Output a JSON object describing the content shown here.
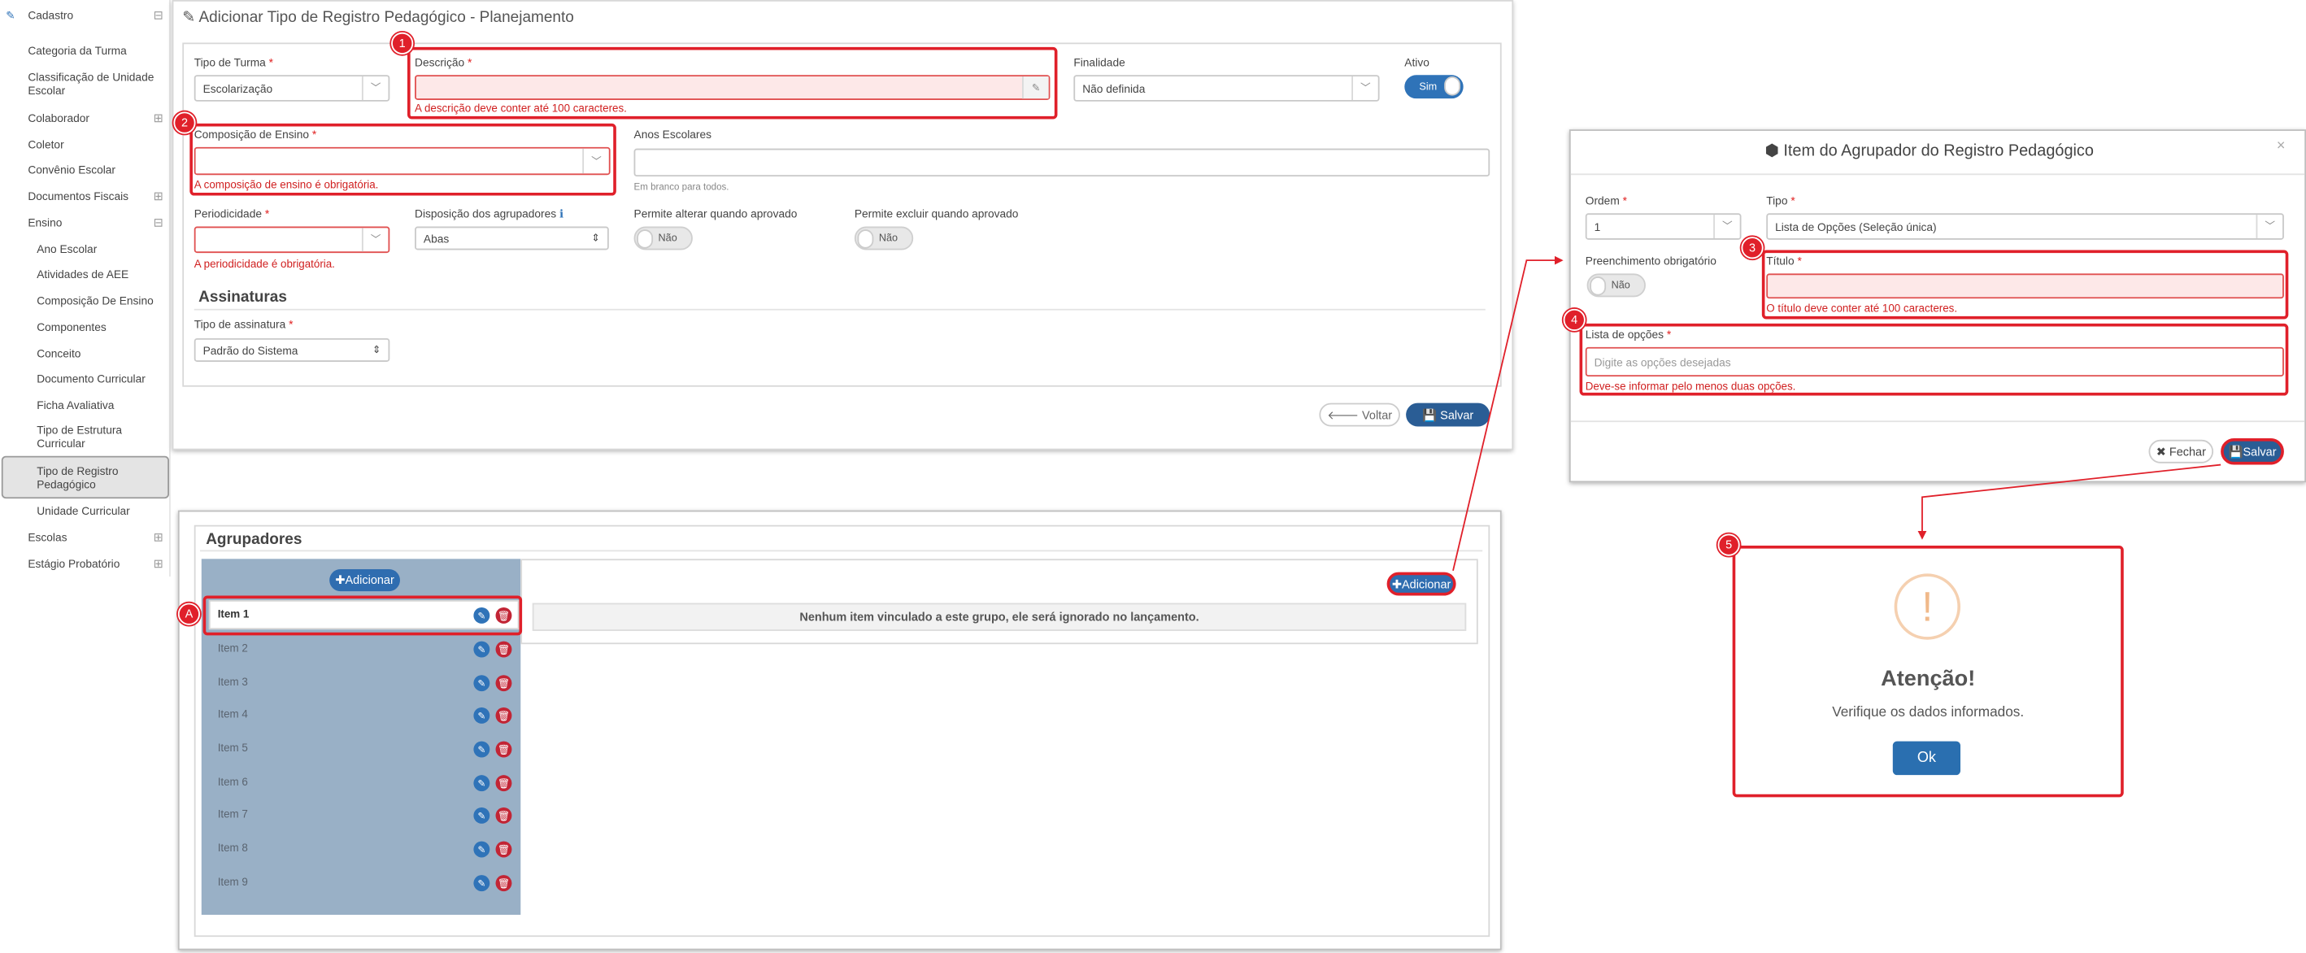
{
  "sidebar": {
    "items": [
      {
        "label": "Cadastro",
        "toggle": "⊟"
      },
      {
        "label": "Categoria da Turma"
      },
      {
        "label": "Classificação de Unidade Escolar"
      },
      {
        "label": "Colaborador",
        "toggle": "⊞"
      },
      {
        "label": "Coletor"
      },
      {
        "label": "Convênio Escolar"
      },
      {
        "label": "Documentos Fiscais",
        "toggle": "⊞"
      },
      {
        "label": "Ensino",
        "toggle": "⊟"
      },
      {
        "label": "Ano Escolar"
      },
      {
        "label": "Atividades de AEE"
      },
      {
        "label": "Composição De Ensino"
      },
      {
        "label": "Componentes"
      },
      {
        "label": "Conceito"
      },
      {
        "label": "Documento Curricular"
      },
      {
        "label": "Ficha Avaliativa"
      },
      {
        "label": "Tipo de Estrutura Curricular"
      },
      {
        "label": "Tipo de Registro Pedagógico"
      },
      {
        "label": "Unidade Curricular"
      },
      {
        "label": "Escolas",
        "toggle": "⊞"
      },
      {
        "label": "Estágio Probatório",
        "toggle": "⊞"
      }
    ]
  },
  "form": {
    "title": "Adicionar Tipo de Registro Pedagógico - Planejamento",
    "tipo_turma_label": "Tipo de Turma",
    "tipo_turma_value": "Escolarização",
    "descricao_label": "Descrição",
    "descricao_error": "A descrição deve conter até 100 caracteres.",
    "finalidade_label": "Finalidade",
    "finalidade_value": "Não definida",
    "ativo_label": "Ativo",
    "ativo_value": "Sim",
    "composicao_label": "Composição de Ensino",
    "composicao_error": "A composição de ensino é obrigatória.",
    "anos_label": "Anos Escolares",
    "anos_hint": "Em branco para todos.",
    "periodicidade_label": "Periodicidade",
    "periodicidade_error": "A periodicidade é obrigatória.",
    "disposicao_label": "Disposição dos agrupadores",
    "disposicao_value": "Abas",
    "permite_alterar_label": "Permite alterar quando aprovado",
    "permite_alterar_value": "Não",
    "permite_excluir_label": "Permite excluir quando aprovado",
    "permite_excluir_value": "Não",
    "assinaturas_title": "Assinaturas",
    "tipo_assinatura_label": "Tipo de assinatura",
    "tipo_assinatura_value": "Padrão do Sistema",
    "voltar_label": "Voltar",
    "salvar_label": "Salvar",
    "required_mark": "*"
  },
  "agrupadores": {
    "title": "Agrupadores",
    "add_label": "Adicionar",
    "items": [
      "Item 1",
      "Item 2",
      "Item 3",
      "Item 4",
      "Item 5",
      "Item 6",
      "Item 7",
      "Item 8",
      "Item 9"
    ],
    "add_item_label": "Adicionar",
    "empty_message": "Nenhum item vinculado a este grupo, ele será ignorado no lançamento."
  },
  "modal": {
    "title": "Item do Agrupador do Registro Pedagógico",
    "close": "×",
    "ordem_label": "Ordem",
    "ordem_value": "1",
    "tipo_label": "Tipo",
    "tipo_value": "Lista de Opções (Seleção única)",
    "preenchimento_label": "Preenchimento obrigatório",
    "preenchimento_value": "Não",
    "titulo_label": "Título",
    "titulo_error": "O título deve conter até 100 caracteres.",
    "lista_label": "Lista de opções",
    "lista_placeholder": "Digite as opções desejadas",
    "lista_error": "Deve-se informar pelo menos duas opções.",
    "fechar_label": "Fechar",
    "salvar_label": "Salvar"
  },
  "alert": {
    "title": "Atenção!",
    "message": "Verifique os dados informados.",
    "ok_label": "Ok",
    "icon": "!"
  },
  "annotations": {
    "n1": "1",
    "n2": "2",
    "n3": "3",
    "n4": "4",
    "n5": "5",
    "nA": "A"
  },
  "colors": {
    "primary": "#2a5d95",
    "annotation_red": "#e0202a",
    "error_red": "#d02020",
    "list_bg": "#99b0c6",
    "warning": "#f0b98a"
  }
}
